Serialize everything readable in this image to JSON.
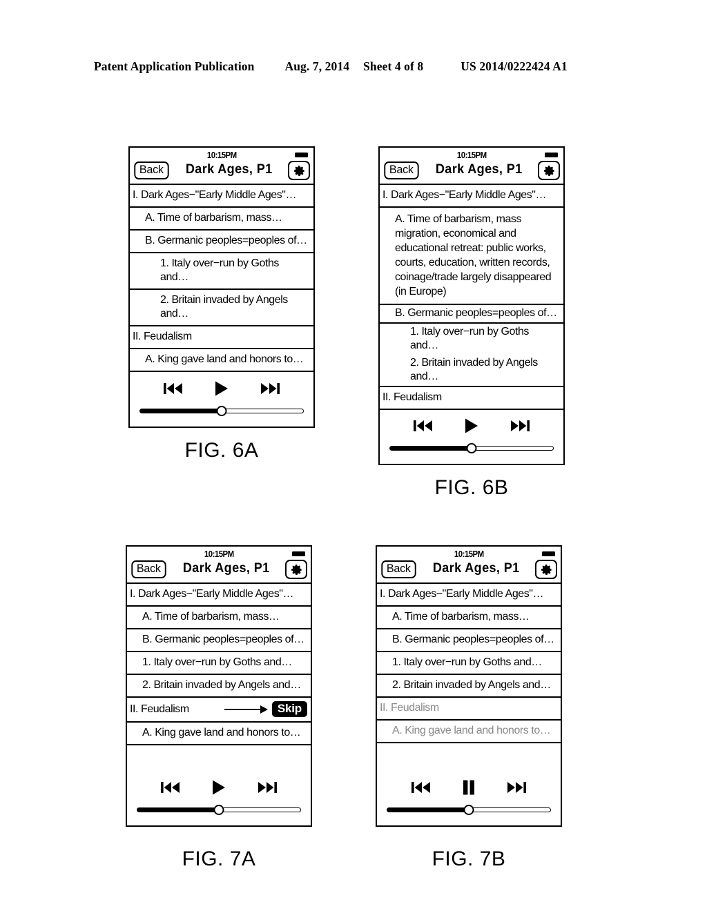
{
  "patent_header": {
    "publication": "Patent Application Publication",
    "date": "Aug. 7, 2014",
    "sheet": "Sheet 4 of 8",
    "number": "US 2014/0222424 A1"
  },
  "common": {
    "clock": "10:15PM",
    "back_label": "Back",
    "title": "Dark Ages, P1",
    "gear_icon": "gear-icon",
    "battery_icon": "battery-icon",
    "prev_icon": "skip-backward-icon",
    "play_icon": "play-icon",
    "pause_icon": "pause-icon",
    "next_icon": "skip-forward-icon",
    "progress_percent": 50
  },
  "figures": [
    {
      "caption": "FIG. 6A",
      "rows": [
        {
          "level": 1,
          "text": "I. Dark Ages−\"Early Middle Ages\"…",
          "dim": false
        },
        {
          "level": 2,
          "text": "A. Time of barbarism, mass…",
          "dim": false
        },
        {
          "level": 2,
          "text": "B. Germanic peoples=peoples of…",
          "dim": false
        },
        {
          "level": 3,
          "text": "1. Italy over−run by Goths and…",
          "dim": false
        },
        {
          "level": 3,
          "text": "2. Britain invaded by Angels and…",
          "dim": false
        },
        {
          "level": 1,
          "text": "II. Feudalism",
          "dim": false
        },
        {
          "level": 2,
          "text": "A. King gave land and honors to…",
          "dim": false
        }
      ],
      "transport": "play",
      "skip": null
    },
    {
      "caption": "FIG. 6B",
      "rows": [
        {
          "level": 1,
          "text": "I. Dark Ages−\"Early Middle Ages\"…",
          "dim": false
        },
        {
          "level": 2,
          "text": "A. Time of barbarism, mass migration, economical and educational retreat: public works, courts, education, written records, coinage/trade largely disappeared (in Europe)",
          "dim": false,
          "block": true
        },
        {
          "level": 2,
          "text": "B. Germanic peoples=peoples of…",
          "dim": false,
          "compact": true
        },
        {
          "level": 3,
          "text": "1. Italy over−run by Goths and…",
          "dim": false,
          "compact": true,
          "nobottom": true
        },
        {
          "level": 3,
          "text": "2. Britain invaded by Angels and…",
          "dim": false,
          "compact": true
        },
        {
          "level": 1,
          "text": "II. Feudalism",
          "dim": false
        }
      ],
      "transport": "play",
      "skip": null
    },
    {
      "caption": "FIG. 7A",
      "rows": [
        {
          "level": 1,
          "text": "I. Dark Ages−\"Early Middle Ages\"…",
          "dim": false
        },
        {
          "level": 2,
          "text": "A. Time of barbarism, mass…",
          "dim": false
        },
        {
          "level": 2,
          "text": "B. Germanic peoples=peoples of…",
          "dim": false
        },
        {
          "level": 2,
          "text": "1. Italy over−run by Goths and…",
          "dim": false
        },
        {
          "level": 2,
          "text": "2. Britain invaded by Angels and…",
          "dim": false
        },
        {
          "level": 1,
          "text": "II. Feudalism",
          "dim": false,
          "skip": true
        },
        {
          "level": 2,
          "text": "A. King gave land and honors to…",
          "dim": false
        }
      ],
      "transport": "play",
      "skip": {
        "label": "Skip",
        "arrow_icon": "right-arrow-icon"
      }
    },
    {
      "caption": "FIG. 7B",
      "rows": [
        {
          "level": 1,
          "text": "I. Dark Ages−\"Early Middle Ages\"…",
          "dim": false
        },
        {
          "level": 2,
          "text": "A. Time of barbarism, mass…",
          "dim": false
        },
        {
          "level": 2,
          "text": "B. Germanic peoples=peoples of…",
          "dim": false
        },
        {
          "level": 2,
          "text": "1. Italy over−run by Goths and…",
          "dim": false
        },
        {
          "level": 2,
          "text": "2. Britain invaded by Angels and…",
          "dim": false
        },
        {
          "level": 1,
          "text": "II. Feudalism",
          "dim": true
        },
        {
          "level": 2,
          "text": "A. King gave land and honors to…",
          "dim": true
        }
      ],
      "transport": "pause",
      "skip": null
    }
  ]
}
